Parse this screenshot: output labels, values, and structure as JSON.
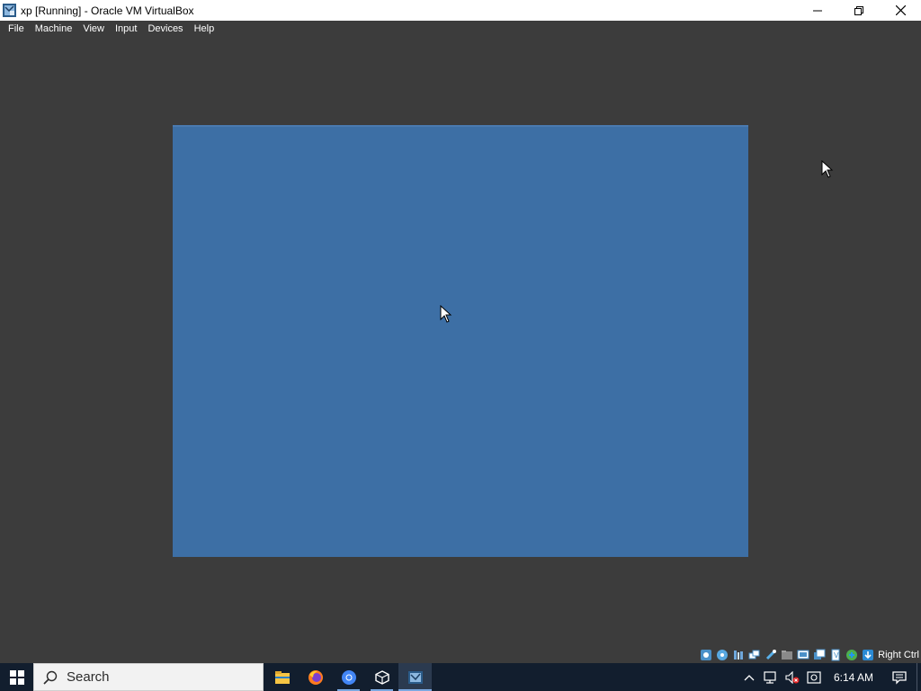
{
  "window": {
    "title": "xp [Running] - Oracle VM VirtualBox",
    "icon": "virtualbox-icon",
    "controls": [
      "minimize-icon",
      "restore-icon",
      "close-icon"
    ]
  },
  "menu": {
    "items": [
      "File",
      "Machine",
      "View",
      "Input",
      "Devices",
      "Help"
    ]
  },
  "vm": {
    "screen_color": "#3d6fa5"
  },
  "statusbar": {
    "icons": [
      "hard-disk-icon",
      "optical-drive-icon",
      "audio-icon",
      "network-icon",
      "usb-icon",
      "shared-folders-icon",
      "display-icon",
      "video-capture-icon",
      "cpu-icon",
      "mouse-integration-icon",
      "keyboard-icon"
    ],
    "host_key": "Right Ctrl"
  },
  "taskbar": {
    "search_label": "Search",
    "apps": [
      "file-explorer-icon",
      "firefox-icon",
      "chrome-icon",
      "virtualbox-manager-icon",
      "virtualbox-vm-icon"
    ],
    "tray_icons": [
      "chevron-up-icon",
      "network-icon",
      "volume-muted-icon",
      "action-icon"
    ],
    "time": "6:14 AM",
    "notification_icon": "notification-icon"
  },
  "colors": {
    "background": "#3c3c3c",
    "vm_screen": "#3d6fa5",
    "taskbar": "#121e2e"
  }
}
